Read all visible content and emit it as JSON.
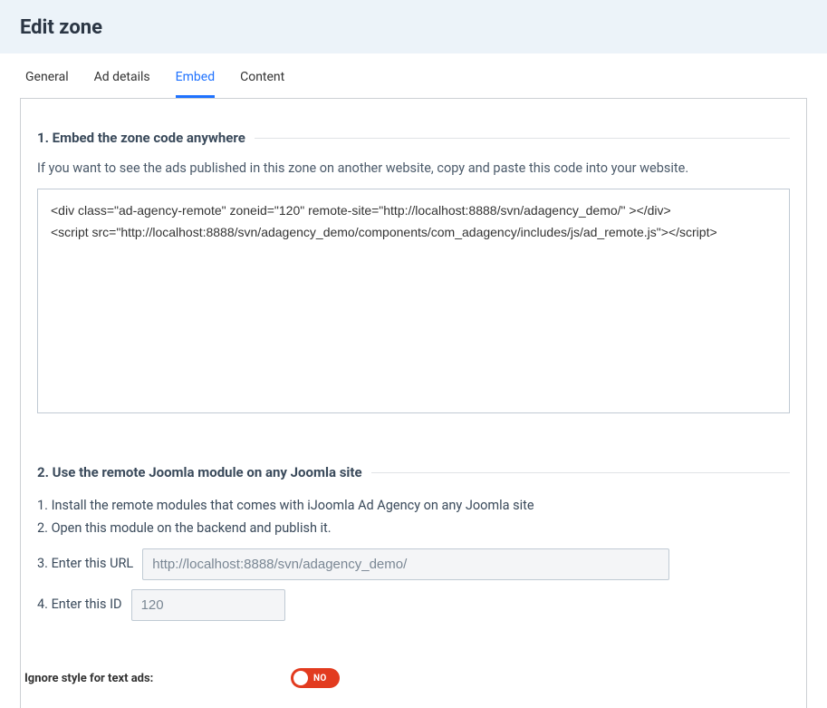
{
  "header": {
    "title": "Edit zone"
  },
  "tabs": [
    {
      "label": "General",
      "active": false
    },
    {
      "label": "Ad details",
      "active": false
    },
    {
      "label": "Embed",
      "active": true
    },
    {
      "label": "Content",
      "active": false
    }
  ],
  "embed": {
    "section1": {
      "title": "1. Embed the zone code anywhere",
      "desc": "If you want to see the ads published in this zone on another website, copy and paste this code into your website.",
      "code": "<div class=\"ad-agency-remote\" zoneid=\"120\" remote-site=\"http://localhost:8888/svn/adagency_demo/\" ></div>\n<script src=\"http://localhost:8888/svn/adagency_demo/components/com_adagency/includes/js/ad_remote.js\"></script>"
    },
    "section2": {
      "title": "2. Use the remote Joomla module on any Joomla site",
      "step1": "1. Install the remote modules that comes with iJoomla Ad Agency on any Joomla site",
      "step2": "2. Open this module on the backend and publish it.",
      "step3_label": "3. Enter this URL",
      "step3_value": "http://localhost:8888/svn/adagency_demo/",
      "step4_label": "4. Enter this ID",
      "step4_value": "120"
    },
    "toggle": {
      "label": "Ignore style for text ads:",
      "state_text": "NO",
      "value": false
    }
  }
}
